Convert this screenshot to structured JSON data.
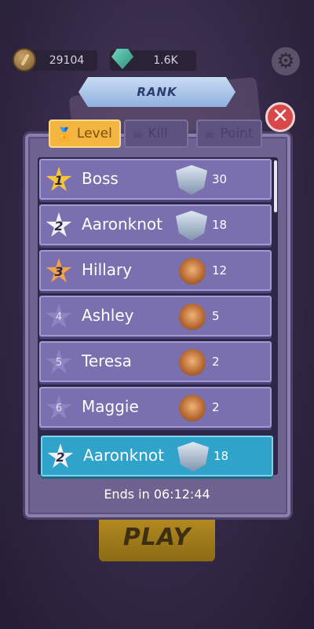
{
  "currency": {
    "coins": "29104",
    "gems": "1.6K"
  },
  "icons": {
    "coin": "coin-icon",
    "gem": "gem-icon",
    "settings": "gear-icon",
    "close": "close-icon",
    "level_tab": "medal-icon",
    "kill_tab": "skull-icon",
    "point_tab": "skull-icon"
  },
  "dialog": {
    "title": "RANK",
    "close_label": "✕"
  },
  "tabs": [
    {
      "label": "Level",
      "active": true
    },
    {
      "label": "Kill",
      "active": false
    },
    {
      "label": "Point",
      "active": false
    }
  ],
  "rankings": [
    {
      "rank": "1",
      "name": "Boss",
      "score": "30",
      "badge": "silver-shield"
    },
    {
      "rank": "2",
      "name": "Aaronknot",
      "score": "18",
      "badge": "silver-shield"
    },
    {
      "rank": "3",
      "name": "Hillary",
      "score": "12",
      "badge": "bronze-medal"
    },
    {
      "rank": "4",
      "name": "Ashley",
      "score": "5",
      "badge": "bronze-medal"
    },
    {
      "rank": "5",
      "name": "Teresa",
      "score": "2",
      "badge": "bronze-medal"
    },
    {
      "rank": "6",
      "name": "Maggie",
      "score": "2",
      "badge": "bronze-medal"
    }
  ],
  "self_row": {
    "rank": "2",
    "name": "Aaronknot",
    "score": "18",
    "badge": "silver-shield"
  },
  "footer": {
    "ends_text": "Ends in 06:12:44"
  },
  "background": {
    "play_label": "PLAY"
  },
  "colors": {
    "active_tab": "#f4b540",
    "row": "#7a70b0",
    "self_row": "#2fa3c9",
    "close": "#d94848"
  }
}
